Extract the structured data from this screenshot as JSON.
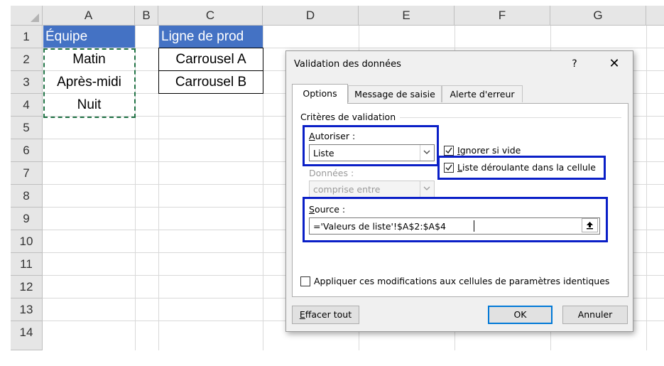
{
  "spreadsheet": {
    "columns": [
      {
        "label": "A"
      },
      {
        "label": "B"
      },
      {
        "label": "C"
      },
      {
        "label": "D"
      },
      {
        "label": "E"
      },
      {
        "label": "F"
      },
      {
        "label": "G"
      }
    ],
    "rows": [
      "1",
      "2",
      "3",
      "4",
      "5",
      "6",
      "7",
      "8",
      "9",
      "10",
      "11",
      "12",
      "13",
      "14"
    ],
    "cells": {
      "A1": "Équipe",
      "A2": "Matin",
      "A3": "Après-midi",
      "A4": "Nuit",
      "C1": "Ligne de prod",
      "C2": "Carrousel A",
      "C3": "Carrousel B"
    },
    "header_fill_color": "#4472c4",
    "copy_marquee_color": "#217346"
  },
  "dialog": {
    "title": "Validation des données",
    "help_label": "?",
    "close_label": "✕",
    "tabs": [
      {
        "label": "Options",
        "active": true
      },
      {
        "label": "Message de saisie",
        "active": false
      },
      {
        "label": "Alerte d'erreur",
        "active": false
      }
    ],
    "criteria_label": "Critères de validation",
    "allow": {
      "label": "Autoriser :",
      "value": "Liste"
    },
    "data": {
      "label": "Données :",
      "value": "comprise entre",
      "disabled": true
    },
    "ignore_blank": {
      "label": "Ignorer si vide",
      "checked": true
    },
    "in_cell_dropdown": {
      "label": "Liste déroulante dans la cellule",
      "checked": true
    },
    "source": {
      "label": "Source :",
      "value": "='Valeurs de liste'!$A$2:$A$4"
    },
    "apply_all": {
      "label": "Appliquer ces modifications aux cellules de paramètres identiques",
      "checked": false
    },
    "buttons": {
      "clear": "Effacer tout",
      "ok": "OK",
      "cancel": "Annuler"
    },
    "highlight_color": "#0a1fc7"
  }
}
